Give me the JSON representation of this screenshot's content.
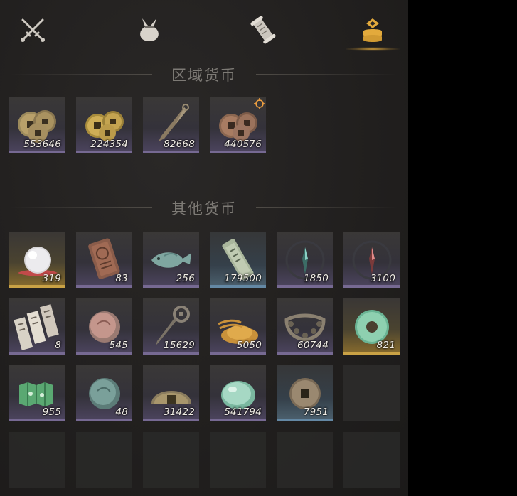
{
  "tabs": [
    {
      "name": "crossed-swords-icon",
      "active": false
    },
    {
      "name": "bundle-icon",
      "active": false
    },
    {
      "name": "scroll-icon",
      "active": false
    },
    {
      "name": "currency-icon",
      "active": true
    }
  ],
  "accent_color": "#e3aa3c",
  "regional": {
    "title": "区域货币",
    "items": [
      {
        "icon": "copper-coins-icon",
        "count": "553646",
        "rarity": "purple"
      },
      {
        "icon": "gold-coins-icon",
        "count": "224354",
        "rarity": "purple"
      },
      {
        "icon": "blade-token-icon",
        "count": "82668",
        "rarity": "purple"
      },
      {
        "icon": "bronze-coins-icon",
        "count": "440576",
        "rarity": "purple",
        "tracked": true
      }
    ]
  },
  "other": {
    "title": "其他货币",
    "items": [
      {
        "icon": "pearl-icon",
        "count": "319",
        "rarity": "gold"
      },
      {
        "icon": "engraved-tablet-icon",
        "count": "83",
        "rarity": "purple"
      },
      {
        "icon": "jade-fish-icon",
        "count": "256",
        "rarity": "purple"
      },
      {
        "icon": "jade-tally-icon",
        "count": "179500",
        "rarity": "blue"
      },
      {
        "icon": "green-sigil-icon",
        "count": "1850",
        "rarity": "purple"
      },
      {
        "icon": "red-sigil-icon",
        "count": "3100",
        "rarity": "purple"
      },
      {
        "icon": "paper-slips-icon",
        "count": "8",
        "rarity": "purple"
      },
      {
        "icon": "pink-stone-icon",
        "count": "545",
        "rarity": "purple"
      },
      {
        "icon": "coin-sword-icon",
        "count": "15629",
        "rarity": "purple"
      },
      {
        "icon": "grain-pile-icon",
        "count": "5050",
        "rarity": "purple"
      },
      {
        "icon": "coin-string-icon",
        "count": "60744",
        "rarity": "purple"
      },
      {
        "icon": "jade-disc-icon",
        "count": "821",
        "rarity": "gold"
      },
      {
        "icon": "green-map-icon",
        "count": "955",
        "rarity": "purple"
      },
      {
        "icon": "teal-stone-icon",
        "count": "48",
        "rarity": "purple"
      },
      {
        "icon": "half-coin-icon",
        "count": "31422",
        "rarity": "purple"
      },
      {
        "icon": "jade-pebble-icon",
        "count": "541794",
        "rarity": "purple"
      },
      {
        "icon": "square-hole-coin-icon",
        "count": "7951",
        "rarity": "blue"
      },
      {
        "icon": "empty-slot",
        "count": "",
        "rarity": "empty"
      }
    ]
  }
}
